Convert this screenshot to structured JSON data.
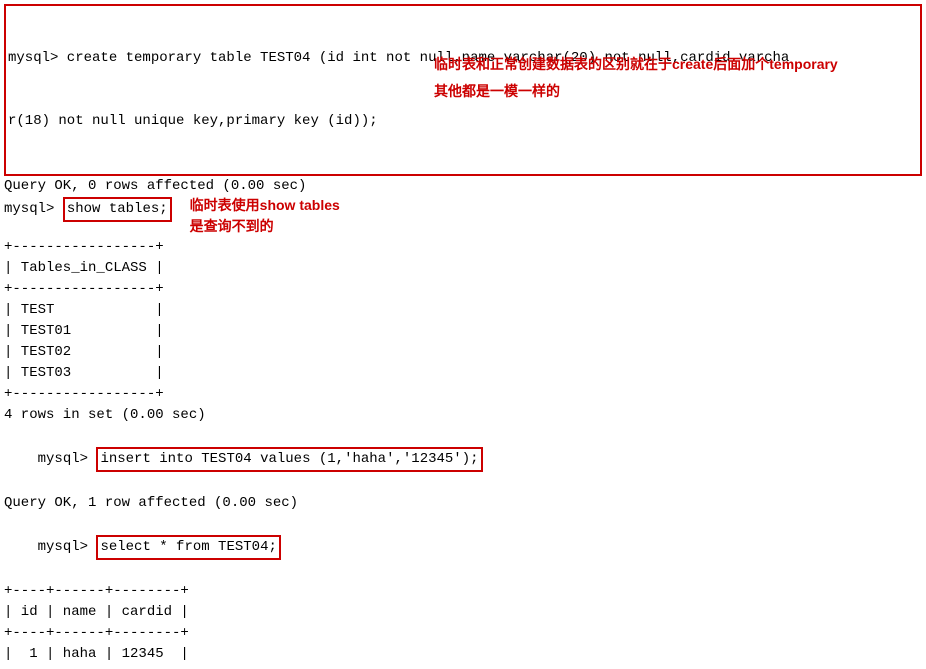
{
  "create_stmt": {
    "line1": "mysql> create temporary table TEST04 (id int not null,name varchar(20) not null,cardid varcha",
    "line2": "r(18) not null unique key,primary key (id));"
  },
  "query_ok_0": "Query OK, 0 rows affected (0.00 sec)",
  "prompt": "mysql>",
  "show_tables_cmd": "show tables;",
  "annotation_show": "临时表使用show tables是查询不到的",
  "annotation_right_1": "临时表和正常创建数据表的区别就在于create后面加个temporary",
  "annotation_right_2": "其他都是一模一样的",
  "table_border_top": "+-----------------+",
  "table_header": "| Tables_in_CLASS |",
  "table_border_mid": "+-----------------+",
  "tables": {
    "row1": "| TEST            |",
    "row2": "| TEST01          |",
    "row3": "| TEST02          |",
    "row4": "| TEST03          |"
  },
  "table_border_bot": "+-----------------+",
  "rows_in_set": "4 rows in set (0.00 sec)",
  "insert_cmd": "insert into TEST04 values (1,'haha','12345');",
  "query_ok_1": "Query OK, 1 row affected (0.00 sec)",
  "select_cmd": "select * from TEST04;",
  "result_border_top": "+----+------+--------+",
  "result_header": "| id | name | cardid |",
  "result_border_mid": "+----+------+--------+",
  "result_row": "|  1 | haha | 12345  |",
  "blank": ""
}
